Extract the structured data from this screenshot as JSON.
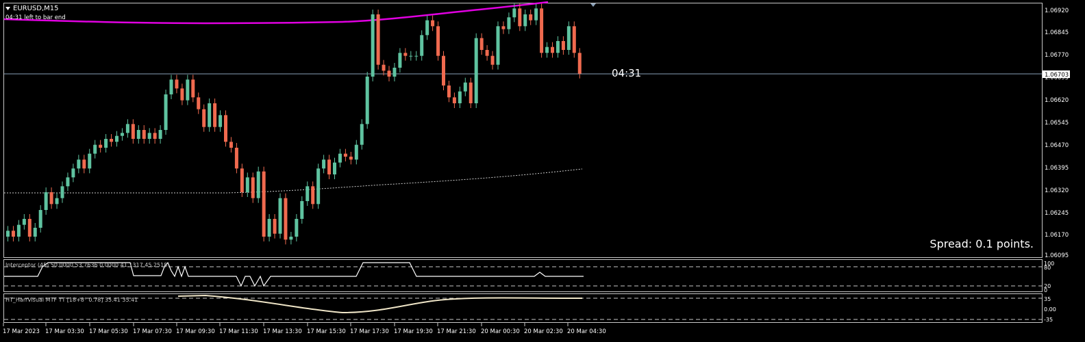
{
  "window": {
    "symbol_title": "EURUSD,M15",
    "bar_timer": "04:31 left to bar end"
  },
  "price_axis": {
    "labels": [
      "1.06920",
      "1.06845",
      "1.06770",
      "1.06695",
      "1.06620",
      "1.06545",
      "1.06470",
      "1.06395",
      "1.06320",
      "1.06245",
      "1.06170",
      "1.06095"
    ],
    "current_price": "1.06703"
  },
  "countdown": "04:31",
  "spread_text": "Spread: 0.1 points.",
  "indicator1": {
    "label": "Interceptor (45) 50.0000 53.7636 0.0000 41.1317 45.2518",
    "scale": [
      "100",
      "80",
      "20",
      "0"
    ]
  },
  "indicator2": {
    "label": "HT_HarrVisual MTF TT [18+8° 0.78] 35.41 35.41",
    "scale": [
      "35",
      "0.00",
      "-35"
    ]
  },
  "time_axis": [
    "17 Mar 2023",
    "17 Mar 03:30",
    "17 Mar 05:30",
    "17 Mar 07:30",
    "17 Mar 09:30",
    "17 Mar 11:30",
    "17 Mar 13:30",
    "17 Mar 15:30",
    "17 Mar 17:30",
    "17 Mar 19:30",
    "17 Mar 21:30",
    "20 Mar 00:30",
    "20 Mar 02:30",
    "20 Mar 04:30"
  ],
  "colors": {
    "bull": "#5fc3a0",
    "bear": "#f06a4f",
    "ma_magenta": "#e100e1",
    "axis": "#c8c8c8",
    "dotted_line": "#cccccc"
  },
  "chart_data": {
    "type": "candlestick",
    "timeframe": "M15",
    "closes": [
      1.0617,
      1.0615,
      1.0619,
      1.0621,
      1.0615,
      1.0618,
      1.0624,
      1.063,
      1.0626,
      1.0628,
      1.0632,
      1.0635,
      1.0638,
      1.0641,
      1.0638,
      1.0643,
      1.0646,
      1.0645,
      1.0648,
      1.0647,
      1.0649,
      1.065,
      1.0653,
      1.0648,
      1.0651,
      1.0648,
      1.065,
      1.0648,
      1.0651,
      1.0663,
      1.0668,
      1.0665,
      1.0661,
      1.0668,
      1.0662,
      1.0658,
      1.0652,
      1.066,
      1.0652,
      1.0656,
      1.0647,
      1.0645,
      1.0638,
      1.063,
      1.0635,
      1.0628,
      1.0637,
      1.0615,
      1.0621,
      1.0616,
      1.0628,
      1.0614,
      1.0615,
      1.0621,
      1.0627,
      1.0632,
      1.0626,
      1.0638,
      1.0641,
      1.0636,
      1.064,
      1.0643,
      1.0642,
      1.0641,
      1.0646,
      1.0653,
      1.0669,
      1.069,
      1.0673,
      1.0671,
      1.0669,
      1.0672,
      1.0677,
      1.0676,
      1.0676,
      1.0676,
      1.0683,
      1.0688,
      1.0686,
      1.0676,
      1.0666,
      1.0662,
      1.066,
      1.0664,
      1.0667,
      1.066,
      1.0682,
      1.0678,
      1.0676,
      1.0673,
      1.0686,
      1.0685,
      1.0689,
      1.0692,
      1.0686,
      1.069,
      1.0688,
      1.0692,
      1.0677,
      1.0679,
      1.0677,
      1.0681,
      1.0678,
      1.0686,
      1.0677,
      1.067
    ],
    "last_price": 1.06703,
    "y_range": [
      1.0609,
      1.0693
    ]
  }
}
